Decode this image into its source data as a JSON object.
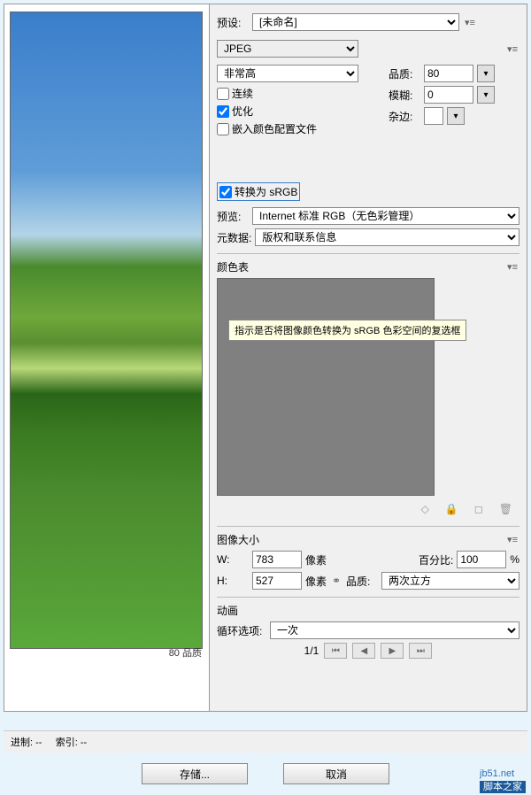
{
  "preset": {
    "label": "预设:",
    "value": "[未命名]"
  },
  "format": {
    "value": "JPEG"
  },
  "quality_select": {
    "value": "非常高"
  },
  "quality": {
    "label": "品质:",
    "value": "80"
  },
  "progressive": {
    "label": "连续",
    "checked": false
  },
  "blur": {
    "label": "模糊:",
    "value": "0"
  },
  "optimize": {
    "label": "优化",
    "checked": true
  },
  "matte": {
    "label": "杂边:"
  },
  "embed_profile": {
    "label": "嵌入颜色配置文件",
    "checked": false
  },
  "convert_srgb": {
    "label": "转换为 sRGB",
    "checked": true
  },
  "preview_label": {
    "label": "预览:",
    "value": "Internet 标准 RGB（无色彩管理）"
  },
  "tooltip": "指示是否将图像颜色转换为 sRGB 色彩空间的复选框",
  "metadata": {
    "label": "元数据:",
    "value": "版权和联系信息"
  },
  "color_table": {
    "label": "颜色表"
  },
  "image_size": {
    "label": "图像大小",
    "w_label": "W:",
    "w": "783",
    "h_label": "H:",
    "h": "527",
    "unit": "像素",
    "percent_label": "百分比:",
    "percent": "100",
    "percent_unit": "%",
    "q_label": "品质:",
    "q_value": "两次立方"
  },
  "anim": {
    "label": "动画",
    "loop_label": "循环选项:",
    "loop_value": "一次",
    "page": "1/1"
  },
  "preview_tag": {
    "quality": "80",
    "qlabel": "品质"
  },
  "status": {
    "progress": "进制: --",
    "index": "索引: --"
  },
  "buttons": {
    "save": "存储...",
    "cancel": "取消"
  },
  "watermark": {
    "site": "jb51.net",
    "brand": "脚本之家"
  }
}
